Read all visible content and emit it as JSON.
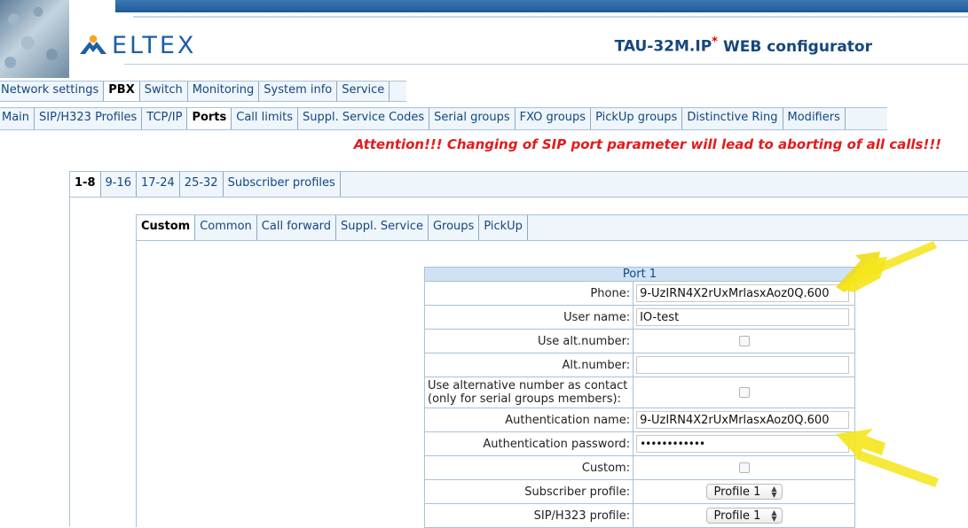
{
  "header": {
    "logo_text": "ELTEX",
    "app_title_model": "TAU-32M.IP",
    "app_title_mark": "*",
    "app_title_rest": "WEB configurator"
  },
  "nav_main": [
    "Network settings",
    "PBX",
    "Switch",
    "Monitoring",
    "System info",
    "Service"
  ],
  "nav_sub": [
    "Main",
    "SIP/H323 Profiles",
    "TCP/IP",
    "Ports",
    "Call limits",
    "Suppl. Service Codes",
    "Serial groups",
    "FXO groups",
    "PickUp groups",
    "Distinctive Ring",
    "Modifiers"
  ],
  "attention": "Attention!!! Changing of SIP port parameter will lead to aborting of all calls!!!",
  "port_tabs": [
    "1-8",
    "9-16",
    "17-24",
    "25-32",
    "Subscriber profiles"
  ],
  "custom_tabs": [
    "Custom",
    "Common",
    "Call forward",
    "Suppl. Service",
    "Groups",
    "PickUp"
  ],
  "form": {
    "title": "Port 1",
    "phone": {
      "label": "Phone:",
      "value": "9-UzIRN4X2rUxMrlasxAoz0Q.600"
    },
    "user_name": {
      "label": "User name:",
      "value": "IO-test"
    },
    "use_alt_number": {
      "label": "Use alt.number:",
      "checked": false
    },
    "alt_number": {
      "label": "Alt.number:",
      "value": ""
    },
    "use_alt_as_contact": {
      "label_line1": "Use alternative number as contact",
      "label_line2": "(only for serial groups members):",
      "checked": false
    },
    "auth_name": {
      "label": "Authentication name:",
      "value": "9-UzIRN4X2rUxMrlasxAoz0Q.600"
    },
    "auth_password": {
      "label": "Authentication password:",
      "value": "••••••••••••"
    },
    "custom": {
      "label": "Custom:",
      "checked": false
    },
    "subscriber_profile": {
      "label": "Subscriber profile:",
      "value": "Profile 1"
    },
    "sip_profile": {
      "label": "SIP/H323 profile:",
      "value": "Profile 1"
    }
  },
  "colors": {
    "accent": "#16477d",
    "nav_bg": "#eef5fb",
    "attention": "#e31b1b",
    "arrow": "#f5e51a"
  }
}
